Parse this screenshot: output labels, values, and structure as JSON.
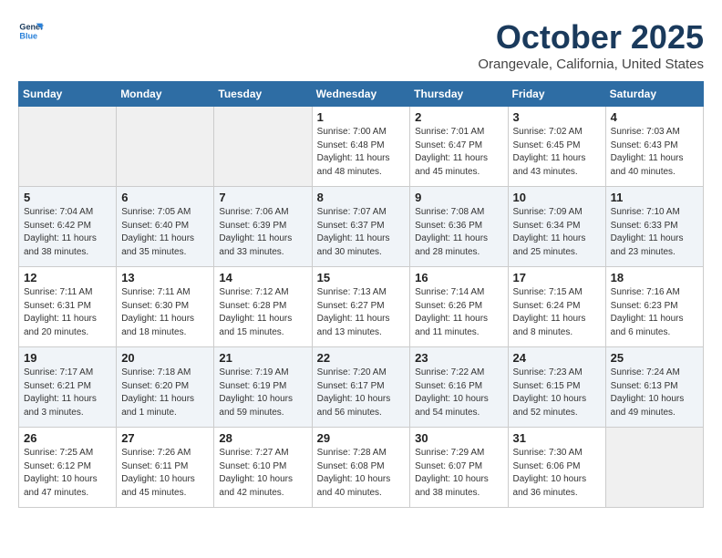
{
  "header": {
    "logo_line1": "General",
    "logo_line2": "Blue",
    "month": "October 2025",
    "location": "Orangevale, California, United States"
  },
  "weekdays": [
    "Sunday",
    "Monday",
    "Tuesday",
    "Wednesday",
    "Thursday",
    "Friday",
    "Saturday"
  ],
  "weeks": [
    [
      {
        "day": "",
        "empty": true
      },
      {
        "day": "",
        "empty": true
      },
      {
        "day": "",
        "empty": true
      },
      {
        "day": "1",
        "sunrise": "7:00 AM",
        "sunset": "6:48 PM",
        "daylight": "11 hours and 48 minutes."
      },
      {
        "day": "2",
        "sunrise": "7:01 AM",
        "sunset": "6:47 PM",
        "daylight": "11 hours and 45 minutes."
      },
      {
        "day": "3",
        "sunrise": "7:02 AM",
        "sunset": "6:45 PM",
        "daylight": "11 hours and 43 minutes."
      },
      {
        "day": "4",
        "sunrise": "7:03 AM",
        "sunset": "6:43 PM",
        "daylight": "11 hours and 40 minutes."
      }
    ],
    [
      {
        "day": "5",
        "sunrise": "7:04 AM",
        "sunset": "6:42 PM",
        "daylight": "11 hours and 38 minutes."
      },
      {
        "day": "6",
        "sunrise": "7:05 AM",
        "sunset": "6:40 PM",
        "daylight": "11 hours and 35 minutes."
      },
      {
        "day": "7",
        "sunrise": "7:06 AM",
        "sunset": "6:39 PM",
        "daylight": "11 hours and 33 minutes."
      },
      {
        "day": "8",
        "sunrise": "7:07 AM",
        "sunset": "6:37 PM",
        "daylight": "11 hours and 30 minutes."
      },
      {
        "day": "9",
        "sunrise": "7:08 AM",
        "sunset": "6:36 PM",
        "daylight": "11 hours and 28 minutes."
      },
      {
        "day": "10",
        "sunrise": "7:09 AM",
        "sunset": "6:34 PM",
        "daylight": "11 hours and 25 minutes."
      },
      {
        "day": "11",
        "sunrise": "7:10 AM",
        "sunset": "6:33 PM",
        "daylight": "11 hours and 23 minutes."
      }
    ],
    [
      {
        "day": "12",
        "sunrise": "7:11 AM",
        "sunset": "6:31 PM",
        "daylight": "11 hours and 20 minutes."
      },
      {
        "day": "13",
        "sunrise": "7:11 AM",
        "sunset": "6:30 PM",
        "daylight": "11 hours and 18 minutes."
      },
      {
        "day": "14",
        "sunrise": "7:12 AM",
        "sunset": "6:28 PM",
        "daylight": "11 hours and 15 minutes."
      },
      {
        "day": "15",
        "sunrise": "7:13 AM",
        "sunset": "6:27 PM",
        "daylight": "11 hours and 13 minutes."
      },
      {
        "day": "16",
        "sunrise": "7:14 AM",
        "sunset": "6:26 PM",
        "daylight": "11 hours and 11 minutes."
      },
      {
        "day": "17",
        "sunrise": "7:15 AM",
        "sunset": "6:24 PM",
        "daylight": "11 hours and 8 minutes."
      },
      {
        "day": "18",
        "sunrise": "7:16 AM",
        "sunset": "6:23 PM",
        "daylight": "11 hours and 6 minutes."
      }
    ],
    [
      {
        "day": "19",
        "sunrise": "7:17 AM",
        "sunset": "6:21 PM",
        "daylight": "11 hours and 3 minutes."
      },
      {
        "day": "20",
        "sunrise": "7:18 AM",
        "sunset": "6:20 PM",
        "daylight": "11 hours and 1 minute."
      },
      {
        "day": "21",
        "sunrise": "7:19 AM",
        "sunset": "6:19 PM",
        "daylight": "10 hours and 59 minutes."
      },
      {
        "day": "22",
        "sunrise": "7:20 AM",
        "sunset": "6:17 PM",
        "daylight": "10 hours and 56 minutes."
      },
      {
        "day": "23",
        "sunrise": "7:22 AM",
        "sunset": "6:16 PM",
        "daylight": "10 hours and 54 minutes."
      },
      {
        "day": "24",
        "sunrise": "7:23 AM",
        "sunset": "6:15 PM",
        "daylight": "10 hours and 52 minutes."
      },
      {
        "day": "25",
        "sunrise": "7:24 AM",
        "sunset": "6:13 PM",
        "daylight": "10 hours and 49 minutes."
      }
    ],
    [
      {
        "day": "26",
        "sunrise": "7:25 AM",
        "sunset": "6:12 PM",
        "daylight": "10 hours and 47 minutes."
      },
      {
        "day": "27",
        "sunrise": "7:26 AM",
        "sunset": "6:11 PM",
        "daylight": "10 hours and 45 minutes."
      },
      {
        "day": "28",
        "sunrise": "7:27 AM",
        "sunset": "6:10 PM",
        "daylight": "10 hours and 42 minutes."
      },
      {
        "day": "29",
        "sunrise": "7:28 AM",
        "sunset": "6:08 PM",
        "daylight": "10 hours and 40 minutes."
      },
      {
        "day": "30",
        "sunrise": "7:29 AM",
        "sunset": "6:07 PM",
        "daylight": "10 hours and 38 minutes."
      },
      {
        "day": "31",
        "sunrise": "7:30 AM",
        "sunset": "6:06 PM",
        "daylight": "10 hours and 36 minutes."
      },
      {
        "day": "",
        "empty": true
      }
    ]
  ]
}
